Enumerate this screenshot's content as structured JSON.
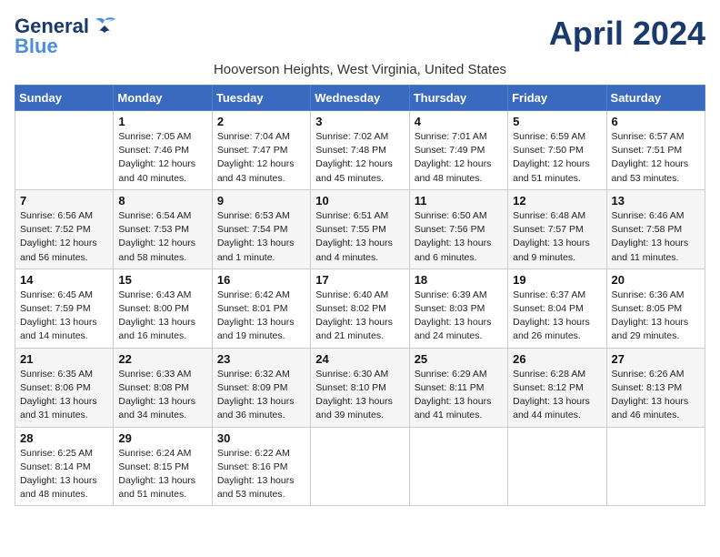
{
  "header": {
    "logo_line1": "General",
    "logo_line2": "Blue",
    "title": "April 2024",
    "subtitle": "Hooverson Heights, West Virginia, United States"
  },
  "days_of_week": [
    "Sunday",
    "Monday",
    "Tuesday",
    "Wednesday",
    "Thursday",
    "Friday",
    "Saturday"
  ],
  "weeks": [
    [
      {
        "day": "",
        "details": ""
      },
      {
        "day": "1",
        "details": "Sunrise: 7:05 AM\nSunset: 7:46 PM\nDaylight: 12 hours\nand 40 minutes."
      },
      {
        "day": "2",
        "details": "Sunrise: 7:04 AM\nSunset: 7:47 PM\nDaylight: 12 hours\nand 43 minutes."
      },
      {
        "day": "3",
        "details": "Sunrise: 7:02 AM\nSunset: 7:48 PM\nDaylight: 12 hours\nand 45 minutes."
      },
      {
        "day": "4",
        "details": "Sunrise: 7:01 AM\nSunset: 7:49 PM\nDaylight: 12 hours\nand 48 minutes."
      },
      {
        "day": "5",
        "details": "Sunrise: 6:59 AM\nSunset: 7:50 PM\nDaylight: 12 hours\nand 51 minutes."
      },
      {
        "day": "6",
        "details": "Sunrise: 6:57 AM\nSunset: 7:51 PM\nDaylight: 12 hours\nand 53 minutes."
      }
    ],
    [
      {
        "day": "7",
        "details": "Sunrise: 6:56 AM\nSunset: 7:52 PM\nDaylight: 12 hours\nand 56 minutes."
      },
      {
        "day": "8",
        "details": "Sunrise: 6:54 AM\nSunset: 7:53 PM\nDaylight: 12 hours\nand 58 minutes."
      },
      {
        "day": "9",
        "details": "Sunrise: 6:53 AM\nSunset: 7:54 PM\nDaylight: 13 hours\nand 1 minute."
      },
      {
        "day": "10",
        "details": "Sunrise: 6:51 AM\nSunset: 7:55 PM\nDaylight: 13 hours\nand 4 minutes."
      },
      {
        "day": "11",
        "details": "Sunrise: 6:50 AM\nSunset: 7:56 PM\nDaylight: 13 hours\nand 6 minutes."
      },
      {
        "day": "12",
        "details": "Sunrise: 6:48 AM\nSunset: 7:57 PM\nDaylight: 13 hours\nand 9 minutes."
      },
      {
        "day": "13",
        "details": "Sunrise: 6:46 AM\nSunset: 7:58 PM\nDaylight: 13 hours\nand 11 minutes."
      }
    ],
    [
      {
        "day": "14",
        "details": "Sunrise: 6:45 AM\nSunset: 7:59 PM\nDaylight: 13 hours\nand 14 minutes."
      },
      {
        "day": "15",
        "details": "Sunrise: 6:43 AM\nSunset: 8:00 PM\nDaylight: 13 hours\nand 16 minutes."
      },
      {
        "day": "16",
        "details": "Sunrise: 6:42 AM\nSunset: 8:01 PM\nDaylight: 13 hours\nand 19 minutes."
      },
      {
        "day": "17",
        "details": "Sunrise: 6:40 AM\nSunset: 8:02 PM\nDaylight: 13 hours\nand 21 minutes."
      },
      {
        "day": "18",
        "details": "Sunrise: 6:39 AM\nSunset: 8:03 PM\nDaylight: 13 hours\nand 24 minutes."
      },
      {
        "day": "19",
        "details": "Sunrise: 6:37 AM\nSunset: 8:04 PM\nDaylight: 13 hours\nand 26 minutes."
      },
      {
        "day": "20",
        "details": "Sunrise: 6:36 AM\nSunset: 8:05 PM\nDaylight: 13 hours\nand 29 minutes."
      }
    ],
    [
      {
        "day": "21",
        "details": "Sunrise: 6:35 AM\nSunset: 8:06 PM\nDaylight: 13 hours\nand 31 minutes."
      },
      {
        "day": "22",
        "details": "Sunrise: 6:33 AM\nSunset: 8:08 PM\nDaylight: 13 hours\nand 34 minutes."
      },
      {
        "day": "23",
        "details": "Sunrise: 6:32 AM\nSunset: 8:09 PM\nDaylight: 13 hours\nand 36 minutes."
      },
      {
        "day": "24",
        "details": "Sunrise: 6:30 AM\nSunset: 8:10 PM\nDaylight: 13 hours\nand 39 minutes."
      },
      {
        "day": "25",
        "details": "Sunrise: 6:29 AM\nSunset: 8:11 PM\nDaylight: 13 hours\nand 41 minutes."
      },
      {
        "day": "26",
        "details": "Sunrise: 6:28 AM\nSunset: 8:12 PM\nDaylight: 13 hours\nand 44 minutes."
      },
      {
        "day": "27",
        "details": "Sunrise: 6:26 AM\nSunset: 8:13 PM\nDaylight: 13 hours\nand 46 minutes."
      }
    ],
    [
      {
        "day": "28",
        "details": "Sunrise: 6:25 AM\nSunset: 8:14 PM\nDaylight: 13 hours\nand 48 minutes."
      },
      {
        "day": "29",
        "details": "Sunrise: 6:24 AM\nSunset: 8:15 PM\nDaylight: 13 hours\nand 51 minutes."
      },
      {
        "day": "30",
        "details": "Sunrise: 6:22 AM\nSunset: 8:16 PM\nDaylight: 13 hours\nand 53 minutes."
      },
      {
        "day": "",
        "details": ""
      },
      {
        "day": "",
        "details": ""
      },
      {
        "day": "",
        "details": ""
      },
      {
        "day": "",
        "details": ""
      }
    ]
  ]
}
